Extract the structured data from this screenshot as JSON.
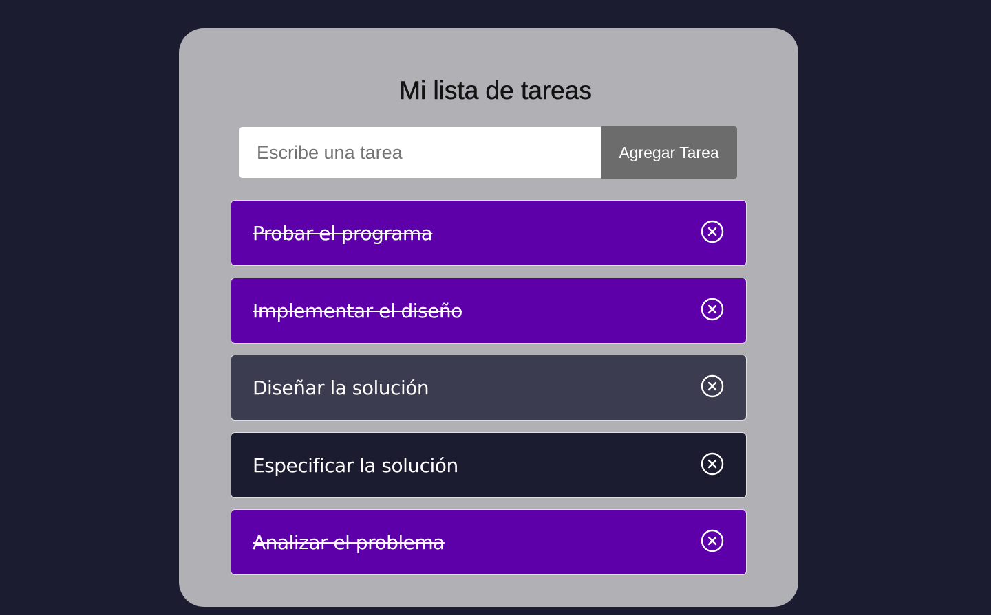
{
  "app": {
    "title": "Mi lista de tareas"
  },
  "form": {
    "input_placeholder": "Escribe una tarea",
    "input_value": "",
    "add_button_label": "Agregar Tarea"
  },
  "colors": {
    "background": "#1c1c31",
    "card": "#b0b0b5",
    "completed_task": "#5e00a9",
    "pending_task_highlight": "#3c3c50",
    "pending_task": "#1c1c31",
    "add_button": "#6c6c6c"
  },
  "tasks": [
    {
      "text": "Probar el programa",
      "completed": true,
      "color": "#5e00a9",
      "icon": "close-circle-icon"
    },
    {
      "text": "Implementar el diseño",
      "completed": true,
      "color": "#5e00a9",
      "icon": "close-circle-icon"
    },
    {
      "text": "Diseñar la solución",
      "completed": false,
      "color": "#3c3c50",
      "icon": "close-circle-icon"
    },
    {
      "text": "Especificar la solución",
      "completed": false,
      "color": "#1c1c31",
      "icon": "close-circle-icon"
    },
    {
      "text": "Analizar el problema",
      "completed": true,
      "color": "#5e00a9",
      "icon": "close-circle-icon"
    }
  ]
}
